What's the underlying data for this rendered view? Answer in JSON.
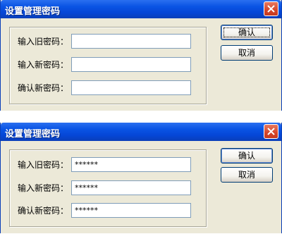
{
  "dialogs": [
    {
      "title": "设置管理密码",
      "labels": {
        "old": "输入旧密码：",
        "new": "输入新密码：",
        "confirm": "确认新密码："
      },
      "values": {
        "old": "",
        "new": "",
        "confirm": ""
      },
      "buttons": {
        "ok": "确认",
        "cancel": "取消"
      }
    },
    {
      "title": "设置管理密码",
      "labels": {
        "old": "输入旧密码：",
        "new": "输入新密码：",
        "confirm": "确认新密码："
      },
      "values": {
        "old": "******",
        "new": "******",
        "confirm": "******"
      },
      "buttons": {
        "ok": "确认",
        "cancel": "取消"
      }
    }
  ],
  "icons": {
    "close": "close-icon"
  },
  "colors": {
    "titlebar": "#0a54e4",
    "close_button": "#d5452a",
    "dialog_bg": "#ece9d8"
  }
}
